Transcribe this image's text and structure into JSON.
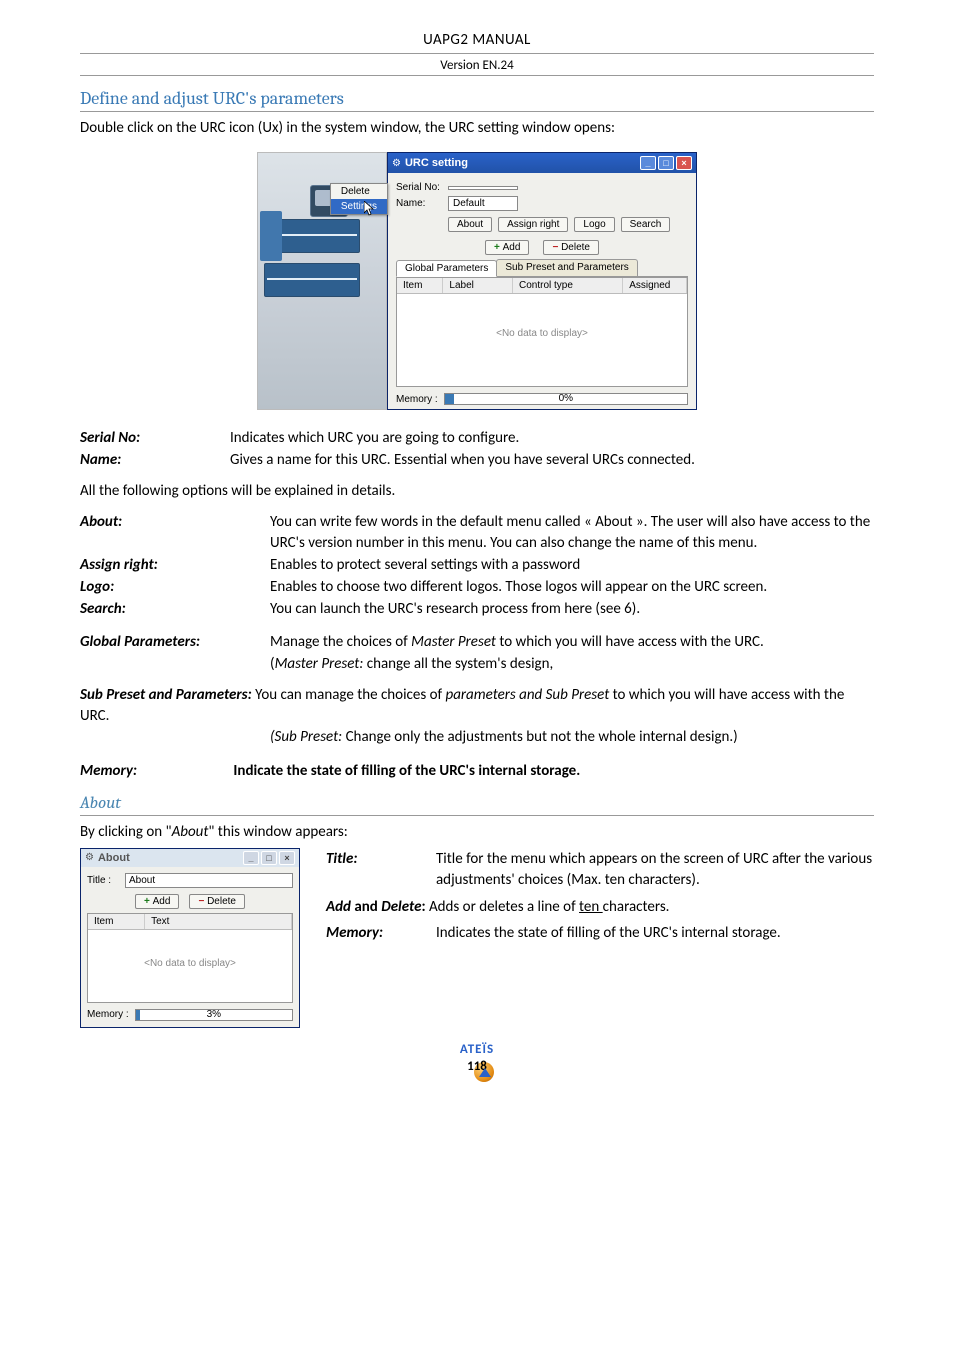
{
  "doc": {
    "title": "UAPG2  MANUAL",
    "version": "Version EN.24"
  },
  "section": {
    "heading": "Define and adjust URC's parameters",
    "intro": "Double click on the URC icon (Ux) in the system window, the URC setting window opens:"
  },
  "context_menu": {
    "delete": "Delete",
    "settings": "Settings"
  },
  "urc_dialog": {
    "title": "URC setting",
    "serial_label": "Serial No:",
    "serial_value": "",
    "name_label": "Name:",
    "name_value": "Default",
    "buttons": {
      "about": "About",
      "assign": "Assign right",
      "logo": "Logo",
      "search": "Search"
    },
    "add": "Add",
    "delete": "Delete",
    "tabs": {
      "global": "Global Parameters",
      "sub": "Sub Preset and Parameters"
    },
    "grid_cols": {
      "c1": "Item",
      "c2": "Label",
      "c3": "Control type",
      "c4": "Assigned"
    },
    "grid_empty": "<No data to display>",
    "memory_label": "Memory :",
    "memory_pct": "0%"
  },
  "defs": {
    "serial_no": {
      "term": "Serial No:",
      "def": "Indicates which URC you are going to configure."
    },
    "name": {
      "term": "Name:",
      "def": "Gives a name for this URC. Essential when you have several URCs connected."
    }
  },
  "note": "All the following options will be explained in details.",
  "defs2": {
    "about": {
      "term": "About:",
      "def1": " You can write few words in the default menu called « About ». The user will also have access to the URC's version number in this menu. You can also change the name of this menu."
    },
    "assign": {
      "term": "Assign right:",
      "def": " Enables to protect several settings with a password"
    },
    "logo": {
      "term": "Logo:",
      "def": " Enables to choose two different logos. Those logos will appear on the URC screen."
    },
    "search": {
      "term": "Search:",
      "def": "You can launch the URC's research process from here (see 6)."
    },
    "global": {
      "term": "Global Parameters:",
      "def1": " Manage the choices of ",
      "def1_i": "Master Preset",
      "def1b": " to which you will have access with the URC.",
      "def2_pre": "(",
      "def2_i": "Master Preset:",
      "def2_post": " change all the system's design,"
    },
    "sub_lead": "Sub Preset and Parameters:",
    "sub_txt1": "  You can manage the choices of ",
    "sub_i": "parameters and Sub Preset",
    "sub_txt2": " to which you will have access with the URC.",
    "sub_txt3_pre": "(Sub Preset:",
    "sub_txt3": " Change only the adjustments but not the whole internal design.)"
  },
  "memory_line": {
    "term": "Memory:",
    "def": "Indicate the state of filling of the URC's internal storage."
  },
  "about_section": {
    "heading": "About",
    "intro": "By clicking on \"",
    "intro_i": "About",
    "intro_tail": "\" this window appears:"
  },
  "about_win": {
    "title": "About",
    "title_label": "Title :",
    "title_value": "About",
    "add": "Add",
    "delete": "Delete",
    "col1": "Item",
    "col2": "Text",
    "empty": "<No data to display>",
    "memory_label": "Memory :",
    "memory_pct": "3%"
  },
  "about_defs": {
    "title": {
      "term": "Title:",
      "def": " Title for the menu which appears on the screen of URC after the various adjustments' choices (Max. ten characters)."
    },
    "adddel_pre": "Add",
    "adddel_mid": " and ",
    "adddel_pre2": "Delete",
    "adddel_colon": ":",
    "adddel_def": " Adds or deletes a line of ",
    "adddel_u": "ten ",
    "adddel_tail": "characters.",
    "memory": {
      "term": "Memory:",
      "def": "Indicates the state of filling of the URC's internal storage."
    }
  },
  "footer": {
    "brand": "ATEÏS",
    "page": "118"
  }
}
